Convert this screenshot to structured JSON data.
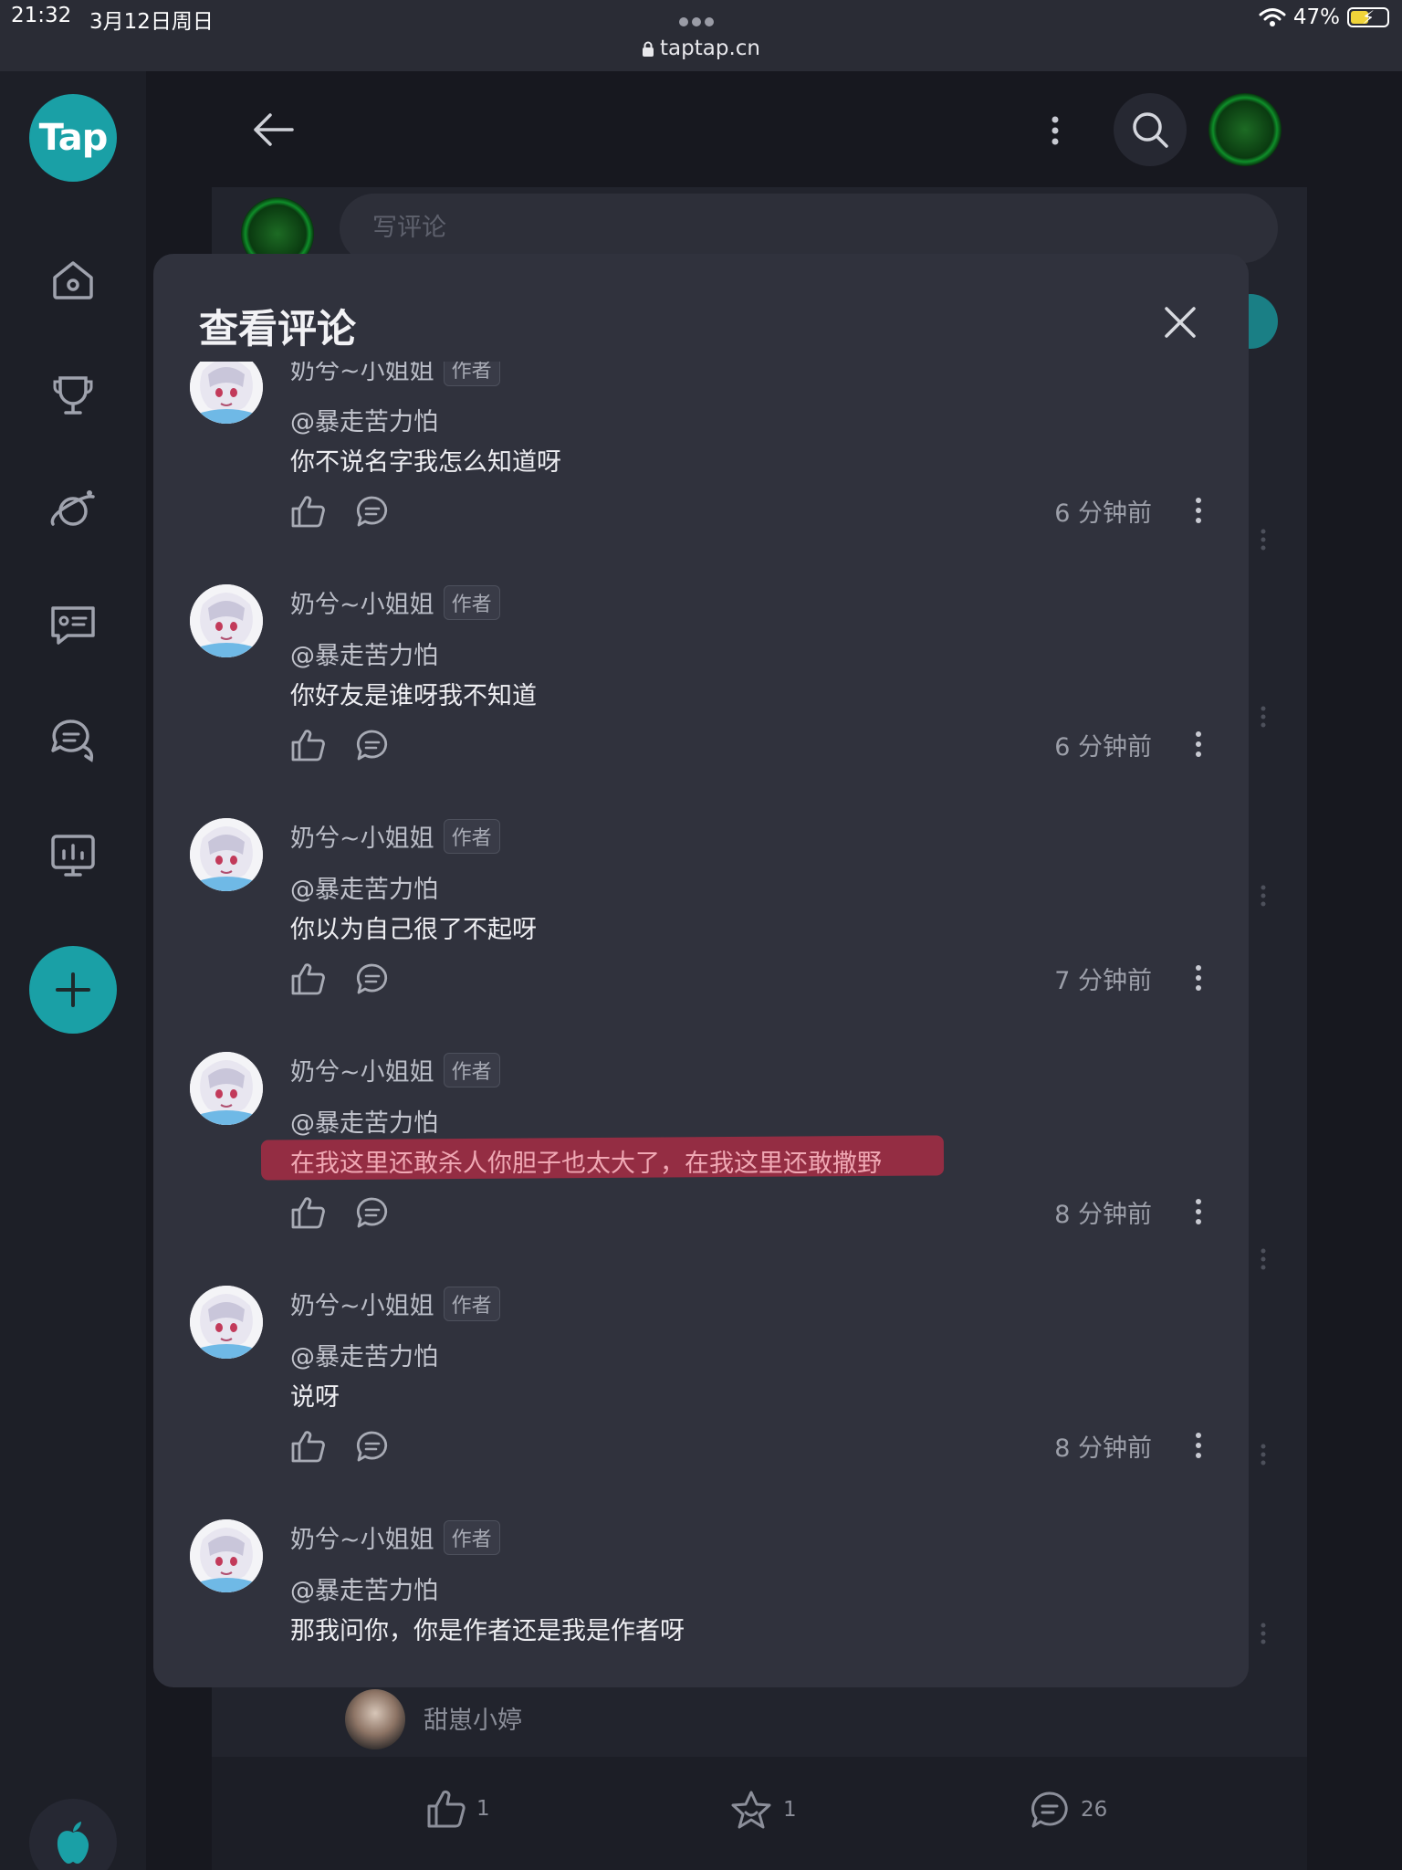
{
  "status_bar": {
    "time": "21:32",
    "date": "3月12日周日",
    "url": "taptap.cn",
    "battery": "47%"
  },
  "sidebar": {
    "logo": "Tap",
    "nav_icons": [
      "home-icon",
      "trophy-icon",
      "planet-icon",
      "message-card-icon",
      "chat-bubbles-icon",
      "dashboard-icon"
    ],
    "add_icon": "plus-icon",
    "bottom_icon": "apple-icon"
  },
  "background": {
    "comment_placeholder": "写评论",
    "user_name": "甜崽小婷",
    "bottom_bar": {
      "likes": "1",
      "favorites": "1",
      "comments": "26"
    }
  },
  "modal": {
    "title": "查看评论",
    "author_badge": "作者",
    "comments": [
      {
        "user": "奶兮~小姐姐",
        "badge": "作者",
        "mention": "@暴走苦力怕",
        "text": "你不说名字我怎么知道呀",
        "time": "6 分钟前",
        "highlighted": false
      },
      {
        "user": "奶兮~小姐姐",
        "badge": "作者",
        "mention": "@暴走苦力怕",
        "text": "你好友是谁呀我不知道",
        "time": "6 分钟前",
        "highlighted": false
      },
      {
        "user": "奶兮~小姐姐",
        "badge": "作者",
        "mention": "@暴走苦力怕",
        "text": "你以为自己很了不起呀",
        "time": "7 分钟前",
        "highlighted": false
      },
      {
        "user": "奶兮~小姐姐",
        "badge": "作者",
        "mention": "@暴走苦力怕",
        "text": "在我这里还敢杀人你胆子也太大了，在我这里还敢撒野",
        "time": "8 分钟前",
        "highlighted": true
      },
      {
        "user": "奶兮~小姐姐",
        "badge": "作者",
        "mention": "@暴走苦力怕",
        "text": "说呀",
        "time": "8 分钟前",
        "highlighted": false
      },
      {
        "user": "奶兮~小姐姐",
        "badge": "作者",
        "mention": "@暴走苦力怕",
        "text": "那我问你，你是作者还是我是作者呀",
        "time": "",
        "highlighted": false
      }
    ]
  },
  "colors": {
    "accent": "#1aa0a6",
    "modal_bg": "#30323d",
    "page_bg": "#17181f",
    "highlight": "#b12b45"
  }
}
